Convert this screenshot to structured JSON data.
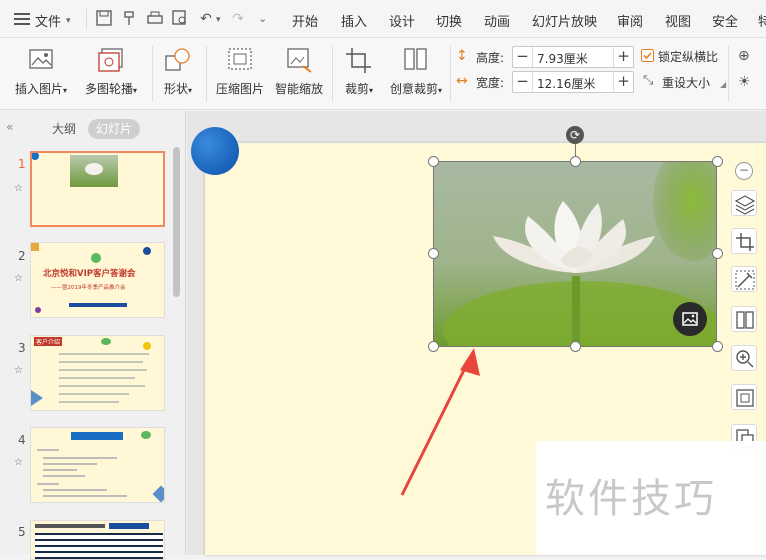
{
  "menubar": {
    "file_label": "文件",
    "items": [
      "开始",
      "插入",
      "设计",
      "切换",
      "动画",
      "幻灯片放映",
      "审阅",
      "视图",
      "安全",
      "特"
    ]
  },
  "ribbon": {
    "insert_picture": "插入图片",
    "multi_carousel": "多图轮播",
    "shape": "形状",
    "compress_picture": "压缩图片",
    "smart_scale": "智能缩放",
    "crop": "裁剪",
    "creative_crop": "创意裁剪",
    "height_label": "高度:",
    "height_value": "7.93厘米",
    "width_label": "宽度:",
    "width_value": "12.16厘米",
    "lock_ratio_label": "锁定纵横比",
    "lock_ratio_checked": true,
    "reset_size_label": "重设大小"
  },
  "leftpanel": {
    "tab_outline": "大纲",
    "tab_slides": "幻灯片",
    "slides": [
      {
        "number": "1",
        "active": true
      },
      {
        "number": "2",
        "active": false,
        "title": "北京悦和VIP客户答谢会",
        "subtitle": "——暨2019年冬季产品推介会"
      },
      {
        "number": "3",
        "active": false,
        "heading": "客户介绍"
      },
      {
        "number": "4",
        "active": false
      },
      {
        "number": "5",
        "active": false
      }
    ]
  },
  "watermark": {
    "text": "软件技巧"
  },
  "colors": {
    "accent_orange": "#e8672b",
    "slide_bg": "#fff9d8",
    "checkbox_orange": "#e8672b",
    "arrow_red": "#e8453c",
    "circle_blue": "#1a6fc4"
  }
}
